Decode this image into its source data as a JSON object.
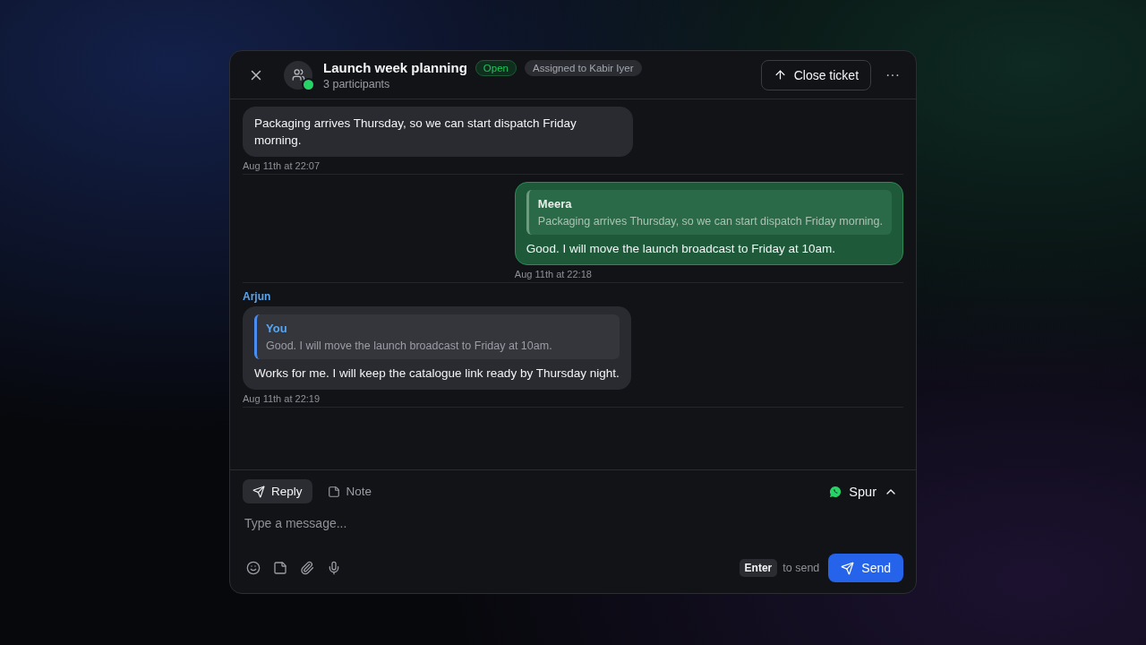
{
  "header": {
    "title": "Launch week planning",
    "status": "Open",
    "assignee": "Assigned to Kabir Iyer",
    "participants": "3 participants",
    "close_button": "Close ticket",
    "more": "···"
  },
  "messages": [
    {
      "kind": "incoming",
      "text": "Packaging arrives Thursday, so we can start dispatch Friday morning.",
      "time": "Aug 11th at 22:07"
    },
    {
      "kind": "outgoing",
      "quote": {
        "author": "Meera",
        "text": "Packaging arrives Thursday, so we can start dispatch Friday morning."
      },
      "text": "Good. I will move the launch broadcast to Friday at 10am.",
      "time": "Aug 11th at 22:18"
    },
    {
      "kind": "incoming",
      "sender": "Arjun",
      "quote": {
        "author": "You",
        "text": "Good. I will move the launch broadcast to Friday at 10am."
      },
      "text": "Works for me. I will keep the catalogue link ready by Thursday night.",
      "time": "Aug 11th at 22:19"
    }
  ],
  "composer": {
    "tabs": [
      {
        "label": "Reply",
        "selected": true
      },
      {
        "label": "Note",
        "selected": false
      }
    ],
    "channel": "Spur",
    "placeholder": "Type a message...",
    "key_hint": "Enter",
    "hint_text": "to send",
    "send_button": "Send"
  }
}
